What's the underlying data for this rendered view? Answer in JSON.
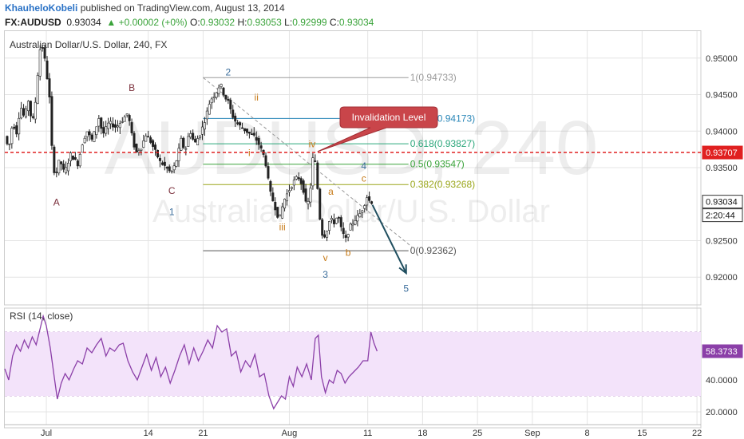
{
  "header": {
    "author": "KhauheloKobeli",
    "published": "published on TradingView.com, August 13, 2014",
    "symbol": "FX:AUDUSD",
    "last": "0.93034",
    "change": "▲ +0.00002 (+0%)",
    "o_label": "O:",
    "o": "0.93032",
    "h_label": "H:",
    "h": "0.93053",
    "l_label": "L:",
    "l": "0.92999",
    "c_label": "C:",
    "c": "0.93034"
  },
  "colors": {
    "candle": "#222222",
    "grid": "#e4e4e4",
    "invalidation": "#e02020",
    "rsi_line": "#8b3fa8",
    "rsi_band": "#f3e3fa",
    "callout": "#c9454a",
    "arrow": "#1f4e5f",
    "wave_blue": "#3c6e9c",
    "wave_orange": "#c77b19",
    "wave_brown": "#7a2e3a"
  },
  "chart_data": [
    {
      "type": "candlestick",
      "title": "Australian Dollar/U.S. Dollar, 240, FX",
      "watermark_big": "AUDUSD, 240",
      "watermark_small": "Australian Dollar/U.S. Dollar",
      "price_axis": {
        "ylim": [
          0.9162,
          0.9538
        ],
        "ticks": [
          "0.95000",
          "0.94500",
          "0.94000",
          "0.93500",
          "0.92500",
          "0.92000"
        ],
        "tick_values": [
          0.95,
          0.945,
          0.94,
          0.935,
          0.925,
          0.92
        ]
      },
      "x_axis": {
        "labels": [
          "Jul",
          "14",
          "21",
          "Aug",
          "11",
          "18",
          "25",
          "Sep",
          "8",
          "15",
          "22"
        ],
        "label_days": [
          1,
          14,
          21,
          32,
          42,
          49,
          56,
          63,
          70,
          77,
          84
        ],
        "day_range": [
          -4.3,
          84.5
        ]
      },
      "last_price_tag": "0.93034",
      "countdown_tag": "2:20:44",
      "invalidation_line": {
        "value": 0.93707,
        "label": "0.93707"
      },
      "callout": {
        "text": "Invalidation Level"
      },
      "fibonacci": [
        {
          "ratio_label": "1(0.94733)",
          "value": 0.94733,
          "color": "#9a9a9a"
        },
        {
          "ratio_label": "0.764(0.94173)",
          "value": 0.94173,
          "color": "#2a87b8"
        },
        {
          "ratio_label": "0.618(0.93827)",
          "value": 0.93827,
          "color": "#2aa67a"
        },
        {
          "ratio_label": "0.5(0.93547)",
          "value": 0.93547,
          "color": "#3aa33a"
        },
        {
          "ratio_label": "0.382(0.93268)",
          "value": 0.93268,
          "color": "#9aa61a"
        },
        {
          "ratio_label": "0(0.92362)",
          "value": 0.92362,
          "color": "#555555"
        }
      ],
      "fib_days": [
        21.0,
        47.2
      ],
      "diagonal": {
        "from": {
          "day": 21.0,
          "value": 0.94733
        },
        "to": {
          "day": 47.8,
          "value": 0.924
        }
      },
      "projection_arrow": {
        "from": {
          "day": 42.6,
          "value": 0.9299
        },
        "to": {
          "day": 46.9,
          "value": 0.92055
        }
      },
      "wave_labels": [
        {
          "text": "A",
          "day": 2.3,
          "value": 0.9298,
          "color": "#7a2e3a"
        },
        {
          "text": "B",
          "day": 11.9,
          "value": 0.9455,
          "color": "#7a2e3a"
        },
        {
          "text": "C",
          "day": 17.0,
          "value": 0.9314,
          "color": "#7a2e3a"
        },
        {
          "text": "1",
          "day": 17.0,
          "value": 0.9285,
          "color": "#3c6e9c"
        },
        {
          "text": "2",
          "day": 24.2,
          "value": 0.9476,
          "color": "#3c6e9c"
        },
        {
          "text": "ii",
          "day": 27.8,
          "value": 0.9442,
          "color": "#c77b19"
        },
        {
          "text": "i",
          "day": 26.9,
          "value": 0.9366,
          "color": "#c77b19"
        },
        {
          "text": "iii",
          "day": 31.1,
          "value": 0.9264,
          "color": "#c77b19"
        },
        {
          "text": "iv",
          "day": 34.9,
          "value": 0.9378,
          "color": "#c77b19"
        },
        {
          "text": "v",
          "day": 36.6,
          "value": 0.9222,
          "color": "#c77b19"
        },
        {
          "text": "3",
          "day": 36.6,
          "value": 0.9199,
          "color": "#3c6e9c"
        },
        {
          "text": "a",
          "day": 37.3,
          "value": 0.9313,
          "color": "#c77b19"
        },
        {
          "text": "b",
          "day": 39.5,
          "value": 0.9229,
          "color": "#c77b19"
        },
        {
          "text": "c",
          "day": 41.5,
          "value": 0.9331,
          "color": "#c77b19"
        },
        {
          "text": "4",
          "day": 41.5,
          "value": 0.9348,
          "color": "#3c6e9c"
        },
        {
          "text": "5",
          "day": 46.9,
          "value": 0.918,
          "color": "#3c6e9c"
        }
      ],
      "price_path": [
        [
          -4.0,
          0.9393
        ],
        [
          -3.5,
          0.9375
        ],
        [
          -3.0,
          0.9412
        ],
        [
          -2.5,
          0.9398
        ],
        [
          -2.0,
          0.9435
        ],
        [
          -1.5,
          0.9418
        ],
        [
          -1.0,
          0.9442
        ],
        [
          -0.5,
          0.9408
        ],
        [
          0.0,
          0.9448
        ],
        [
          0.4,
          0.9508
        ],
        [
          0.7,
          0.952
        ],
        [
          1.2,
          0.9492
        ],
        [
          1.7,
          0.9445
        ],
        [
          2.0,
          0.9378
        ],
        [
          2.4,
          0.9335
        ],
        [
          3.0,
          0.9362
        ],
        [
          3.6,
          0.9342
        ],
        [
          4.4,
          0.9368
        ],
        [
          5.3,
          0.9355
        ],
        [
          6.0,
          0.9388
        ],
        [
          6.6,
          0.9402
        ],
        [
          7.0,
          0.9385
        ],
        [
          7.5,
          0.94
        ],
        [
          8.0,
          0.9418
        ],
        [
          8.5,
          0.9395
        ],
        [
          9.3,
          0.9412
        ],
        [
          10.2,
          0.9405
        ],
        [
          11.0,
          0.9415
        ],
        [
          11.7,
          0.9425
        ],
        [
          12.2,
          0.9395
        ],
        [
          12.7,
          0.937
        ],
        [
          13.4,
          0.9378
        ],
        [
          14.0,
          0.9395
        ],
        [
          14.5,
          0.9388
        ],
        [
          15.2,
          0.9372
        ],
        [
          15.8,
          0.9358
        ],
        [
          16.4,
          0.9352
        ],
        [
          17.0,
          0.9345
        ],
        [
          17.4,
          0.9345
        ],
        [
          17.9,
          0.936
        ],
        [
          18.5,
          0.9388
        ],
        [
          19.0,
          0.9372
        ],
        [
          19.6,
          0.9402
        ],
        [
          20.2,
          0.9382
        ],
        [
          21.0,
          0.9398
        ],
        [
          21.6,
          0.9418
        ],
        [
          22.2,
          0.9442
        ],
        [
          22.9,
          0.9452
        ],
        [
          23.5,
          0.9465
        ],
        [
          24.0,
          0.9448
        ],
        [
          24.5,
          0.944
        ],
        [
          25.0,
          0.9422
        ],
        [
          25.5,
          0.9412
        ],
        [
          26.2,
          0.9405
        ],
        [
          26.8,
          0.94
        ],
        [
          27.4,
          0.9395
        ],
        [
          27.9,
          0.9392
        ],
        [
          28.5,
          0.938
        ],
        [
          29.2,
          0.9362
        ],
        [
          29.8,
          0.9318
        ],
        [
          30.5,
          0.9295
        ],
        [
          31.0,
          0.9278
        ],
        [
          31.6,
          0.9305
        ],
        [
          32.2,
          0.9318
        ],
        [
          32.8,
          0.933
        ],
        [
          33.4,
          0.9338
        ],
        [
          34.0,
          0.9325
        ],
        [
          34.5,
          0.9295
        ],
        [
          34.9,
          0.931
        ],
        [
          35.3,
          0.9362
        ],
        [
          35.7,
          0.9355
        ],
        [
          36.1,
          0.9288
        ],
        [
          36.6,
          0.9252
        ],
        [
          37.1,
          0.9265
        ],
        [
          37.5,
          0.928
        ],
        [
          38.0,
          0.9275
        ],
        [
          38.5,
          0.9285
        ],
        [
          39.0,
          0.9262
        ],
        [
          39.5,
          0.9252
        ],
        [
          40.0,
          0.9268
        ],
        [
          40.6,
          0.9278
        ],
        [
          41.2,
          0.9285
        ],
        [
          41.7,
          0.9295
        ],
        [
          42.2,
          0.931
        ],
        [
          42.6,
          0.9303
        ]
      ]
    },
    {
      "type": "line",
      "title": "RSI (14, close)",
      "ylim": [
        17,
        83
      ],
      "ticks": [
        "40.0000",
        "20.0000"
      ],
      "tick_values": [
        40,
        20
      ],
      "band": [
        30,
        70
      ],
      "last_value_tag": "58.3733",
      "series": [
        {
          "name": "RSI",
          "points": [
            [
              -4.3,
              47
            ],
            [
              -3.8,
              40
            ],
            [
              -3.3,
              55
            ],
            [
              -2.8,
              62
            ],
            [
              -2.3,
              58
            ],
            [
              -1.8,
              65
            ],
            [
              -1.3,
              60
            ],
            [
              -0.8,
              67
            ],
            [
              -0.3,
              62
            ],
            [
              0.2,
              72
            ],
            [
              0.6,
              80
            ],
            [
              1.0,
              74
            ],
            [
              1.5,
              60
            ],
            [
              2.0,
              42
            ],
            [
              2.4,
              28
            ],
            [
              2.9,
              38
            ],
            [
              3.4,
              44
            ],
            [
              3.9,
              40
            ],
            [
              4.5,
              47
            ],
            [
              5.0,
              52
            ],
            [
              5.6,
              50
            ],
            [
              6.2,
              60
            ],
            [
              6.8,
              57
            ],
            [
              7.4,
              62
            ],
            [
              8.0,
              66
            ],
            [
              8.6,
              55
            ],
            [
              9.1,
              60
            ],
            [
              9.7,
              58
            ],
            [
              10.3,
              62
            ],
            [
              10.8,
              63
            ],
            [
              11.4,
              52
            ],
            [
              12.0,
              45
            ],
            [
              12.6,
              40
            ],
            [
              13.2,
              48
            ],
            [
              13.8,
              56
            ],
            [
              14.4,
              46
            ],
            [
              15.0,
              54
            ],
            [
              15.6,
              42
            ],
            [
              16.2,
              48
            ],
            [
              16.8,
              38
            ],
            [
              17.4,
              46
            ],
            [
              18.0,
              55
            ],
            [
              18.6,
              62
            ],
            [
              19.2,
              50
            ],
            [
              19.8,
              60
            ],
            [
              20.4,
              52
            ],
            [
              21.0,
              58
            ],
            [
              21.6,
              65
            ],
            [
              22.2,
              60
            ],
            [
              22.8,
              74
            ],
            [
              23.4,
              70
            ],
            [
              24.0,
              72
            ],
            [
              24.6,
              55
            ],
            [
              25.2,
              58
            ],
            [
              25.8,
              45
            ],
            [
              26.4,
              52
            ],
            [
              27.0,
              48
            ],
            [
              27.6,
              56
            ],
            [
              28.2,
              42
            ],
            [
              28.8,
              44
            ],
            [
              29.4,
              30
            ],
            [
              30.0,
              22
            ],
            [
              30.5,
              26
            ],
            [
              31.0,
              30
            ],
            [
              31.5,
              28
            ],
            [
              32.0,
              42
            ],
            [
              32.5,
              36
            ],
            [
              33.0,
              48
            ],
            [
              33.6,
              42
            ],
            [
              34.2,
              50
            ],
            [
              34.8,
              40
            ],
            [
              35.3,
              66
            ],
            [
              35.7,
              68
            ],
            [
              36.1,
              42
            ],
            [
              36.6,
              32
            ],
            [
              37.1,
              40
            ],
            [
              37.6,
              38
            ],
            [
              38.1,
              46
            ],
            [
              38.6,
              44
            ],
            [
              39.1,
              38
            ],
            [
              39.6,
              42
            ],
            [
              40.2,
              45
            ],
            [
              40.8,
              48
            ],
            [
              41.4,
              52
            ],
            [
              42.0,
              52
            ],
            [
              42.4,
              70
            ],
            [
              42.8,
              63
            ],
            [
              43.2,
              58
            ]
          ]
        }
      ]
    }
  ]
}
